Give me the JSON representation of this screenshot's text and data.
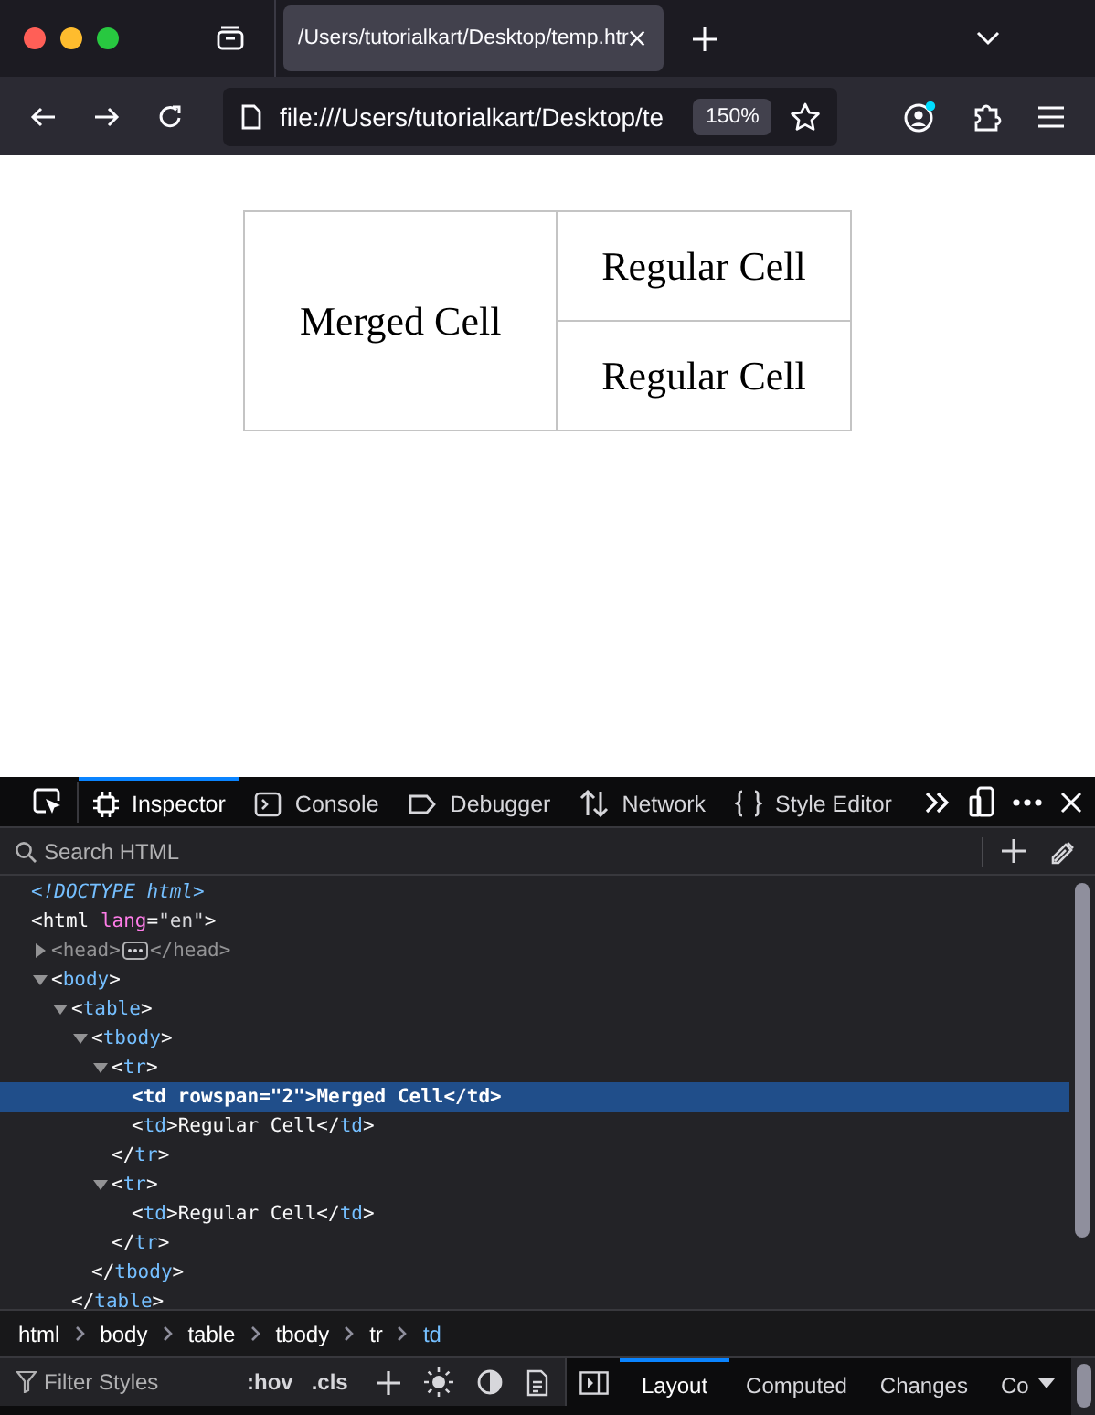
{
  "browser": {
    "tab": {
      "title": "/Users/tutorialkart/Desktop/temp.htr",
      "selected": true
    },
    "address": "file:///Users/tutorialkart/Desktop/te",
    "zoom": "150%"
  },
  "page_table": {
    "rows": [
      [
        {
          "text": "Merged Cell",
          "rowspan": 2
        },
        {
          "text": "Regular Cell"
        }
      ],
      [
        {
          "text": "Regular Cell"
        }
      ]
    ]
  },
  "devtools": {
    "tabs": [
      {
        "label": "Inspector",
        "selected": true
      },
      {
        "label": "Console",
        "selected": false
      },
      {
        "label": "Debugger",
        "selected": false
      },
      {
        "label": "Network",
        "selected": false
      },
      {
        "label": "Style Editor",
        "selected": false
      }
    ],
    "search": {
      "placeholder": "Search HTML"
    },
    "markup": [
      {
        "selected": false,
        "segments": [
          {
            "kind": "doctype",
            "text": "<!DOCTYPE html>"
          }
        ]
      },
      {
        "selected": false,
        "segments": [
          {
            "kind": "punct",
            "text": "<html "
          },
          {
            "kind": "attr",
            "text": "lang"
          },
          {
            "kind": "punct",
            "text": "="
          },
          {
            "kind": "value",
            "text": "\"en\""
          },
          {
            "kind": "punct",
            "text": ">"
          }
        ],
        "children": [
          {
            "selected": false,
            "expanded": false,
            "segments": [
              {
                "kind": "muted",
                "text": "<head>"
              }
            ],
            "tail": [
              {
                "kind": "muted",
                "text": "</head>"
              }
            ]
          },
          {
            "selected": false,
            "expanded": true,
            "segments": [
              {
                "kind": "punct",
                "text": "<"
              },
              {
                "kind": "tag",
                "text": "body"
              },
              {
                "kind": "punct",
                "text": ">"
              }
            ],
            "children": [
              {
                "selected": false,
                "expanded": true,
                "segments": [
                  {
                    "kind": "punct",
                    "text": "<"
                  },
                  {
                    "kind": "tag",
                    "text": "table"
                  },
                  {
                    "kind": "punct",
                    "text": ">"
                  }
                ],
                "children": [
                  {
                    "selected": false,
                    "expanded": true,
                    "segments": [
                      {
                        "kind": "punct",
                        "text": "<"
                      },
                      {
                        "kind": "tag",
                        "text": "tbody"
                      },
                      {
                        "kind": "punct",
                        "text": ">"
                      }
                    ],
                    "children": [
                      {
                        "selected": false,
                        "expanded": true,
                        "segments": [
                          {
                            "kind": "punct",
                            "text": "<"
                          },
                          {
                            "kind": "tag",
                            "text": "tr"
                          },
                          {
                            "kind": "punct",
                            "text": ">"
                          }
                        ],
                        "children": [
                          {
                            "selected": true,
                            "segments": [
                              {
                                "kind": "punct",
                                "text": "<td "
                              },
                              {
                                "kind": "attr",
                                "text": "rowspan"
                              },
                              {
                                "kind": "punct",
                                "text": "="
                              },
                              {
                                "kind": "value",
                                "text": "\"2\""
                              },
                              {
                                "kind": "punct",
                                "text": ">"
                              },
                              {
                                "kind": "text",
                                "text": "Merged Cell"
                              },
                              {
                                "kind": "punct",
                                "text": "</"
                              },
                              {
                                "kind": "tag",
                                "text": "td"
                              },
                              {
                                "kind": "punct",
                                "text": ">"
                              }
                            ]
                          },
                          {
                            "selected": false,
                            "segments": [
                              {
                                "kind": "punct",
                                "text": "<"
                              },
                              {
                                "kind": "tag",
                                "text": "td"
                              },
                              {
                                "kind": "punct",
                                "text": ">"
                              },
                              {
                                "kind": "text",
                                "text": "Regular Cell"
                              },
                              {
                                "kind": "punct",
                                "text": "</"
                              },
                              {
                                "kind": "tag",
                                "text": "td"
                              },
                              {
                                "kind": "punct",
                                "text": ">"
                              }
                            ]
                          }
                        ]
                      },
                      {
                        "selected": false,
                        "segments": [
                          {
                            "kind": "punct",
                            "text": "</"
                          },
                          {
                            "kind": "tag",
                            "text": "tr"
                          },
                          {
                            "kind": "punct",
                            "text": ">"
                          }
                        ]
                      },
                      {
                        "selected": false,
                        "expanded": true,
                        "segments": [
                          {
                            "kind": "punct",
                            "text": "<"
                          },
                          {
                            "kind": "tag",
                            "text": "tr"
                          },
                          {
                            "kind": "punct",
                            "text": ">"
                          }
                        ],
                        "children": [
                          {
                            "selected": false,
                            "segments": [
                              {
                                "kind": "punct",
                                "text": "<"
                              },
                              {
                                "kind": "tag",
                                "text": "td"
                              },
                              {
                                "kind": "punct",
                                "text": ">"
                              },
                              {
                                "kind": "text",
                                "text": "Regular Cell"
                              },
                              {
                                "kind": "punct",
                                "text": "</"
                              },
                              {
                                "kind": "tag",
                                "text": "td"
                              },
                              {
                                "kind": "punct",
                                "text": ">"
                              }
                            ]
                          }
                        ]
                      },
                      {
                        "selected": false,
                        "segments": [
                          {
                            "kind": "punct",
                            "text": "</"
                          },
                          {
                            "kind": "tag",
                            "text": "tr"
                          },
                          {
                            "kind": "punct",
                            "text": ">"
                          }
                        ]
                      }
                    ]
                  },
                  {
                    "selected": false,
                    "segments": [
                      {
                        "kind": "punct",
                        "text": "</"
                      },
                      {
                        "kind": "tag",
                        "text": "tbody"
                      },
                      {
                        "kind": "punct",
                        "text": ">"
                      }
                    ]
                  }
                ]
              },
              {
                "selected": false,
                "segments": [
                  {
                    "kind": "punct",
                    "text": "</"
                  },
                  {
                    "kind": "tag",
                    "text": "table"
                  },
                  {
                    "kind": "punct",
                    "text": ">"
                  }
                ]
              }
            ]
          }
        ]
      }
    ],
    "breadcrumbs": [
      {
        "label": "html",
        "selected": false
      },
      {
        "label": "body",
        "selected": false
      },
      {
        "label": "table",
        "selected": false
      },
      {
        "label": "tbody",
        "selected": false
      },
      {
        "label": "tr",
        "selected": false
      },
      {
        "label": "td",
        "selected": true
      }
    ],
    "rules": {
      "filter_placeholder": "Filter Styles",
      "hov": ":hov",
      "cls": ".cls"
    },
    "sidebar_tabs": [
      {
        "label": "Layout",
        "selected": true
      },
      {
        "label": "Computed",
        "selected": false
      },
      {
        "label": "Changes",
        "selected": false
      },
      {
        "label": "Co",
        "selected": false
      }
    ]
  }
}
